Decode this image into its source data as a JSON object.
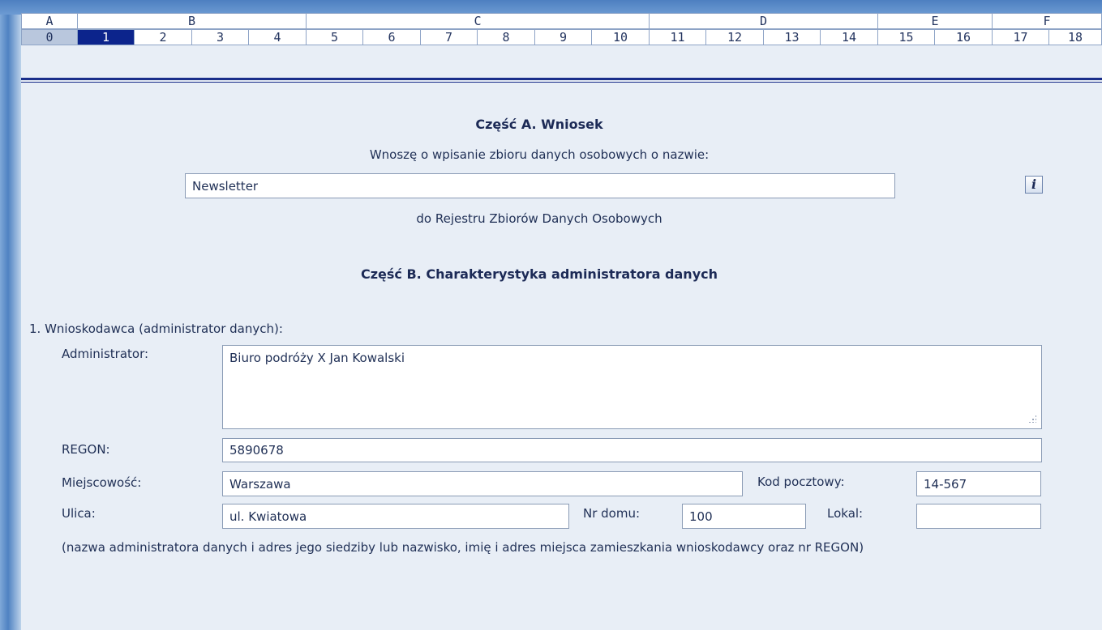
{
  "ruler": {
    "groups": [
      "A",
      "B",
      "C",
      "D",
      "E",
      "F"
    ],
    "steps": [
      "0",
      "1",
      "2",
      "3",
      "4",
      "5",
      "6",
      "7",
      "8",
      "9",
      "10",
      "11",
      "12",
      "13",
      "14",
      "15",
      "16",
      "17",
      "18"
    ],
    "selected_step": "1"
  },
  "partA": {
    "heading": "Część A. Wniosek",
    "intro": "Wnoszę o wpisanie zbioru danych osobowych o nazwie:",
    "name_value": "Newsletter",
    "info_label": "i",
    "suffix": "do Rejestru Zbiorów Danych Osobowych"
  },
  "partB": {
    "heading": "Część B. Charakterystyka administratora danych",
    "section1": "1. Wnioskodawca (administrator danych):",
    "fields": {
      "administrator_label": "Administrator:",
      "administrator_value": "Biuro podróży X Jan Kowalski",
      "regon_label": "REGON:",
      "regon_value": "5890678",
      "city_label": "Miejscowość:",
      "city_value": "Warszawa",
      "postal_label": "Kod pocztowy:",
      "postal_value": "14-567",
      "street_label": "Ulica:",
      "street_value": "ul. Kwiatowa",
      "house_label": "Nr domu:",
      "house_value": "100",
      "flat_label": "Lokal:",
      "flat_value": ""
    },
    "note": "(nazwa administratora danych i adres jego siedziby lub nazwisko, imię i adres miejsca zamieszkania wnioskodawcy oraz nr REGON)"
  },
  "colors": {
    "selected_step_bg": "#0c248c",
    "rule": "#1a2e8a",
    "panel": "#e8eef6"
  }
}
